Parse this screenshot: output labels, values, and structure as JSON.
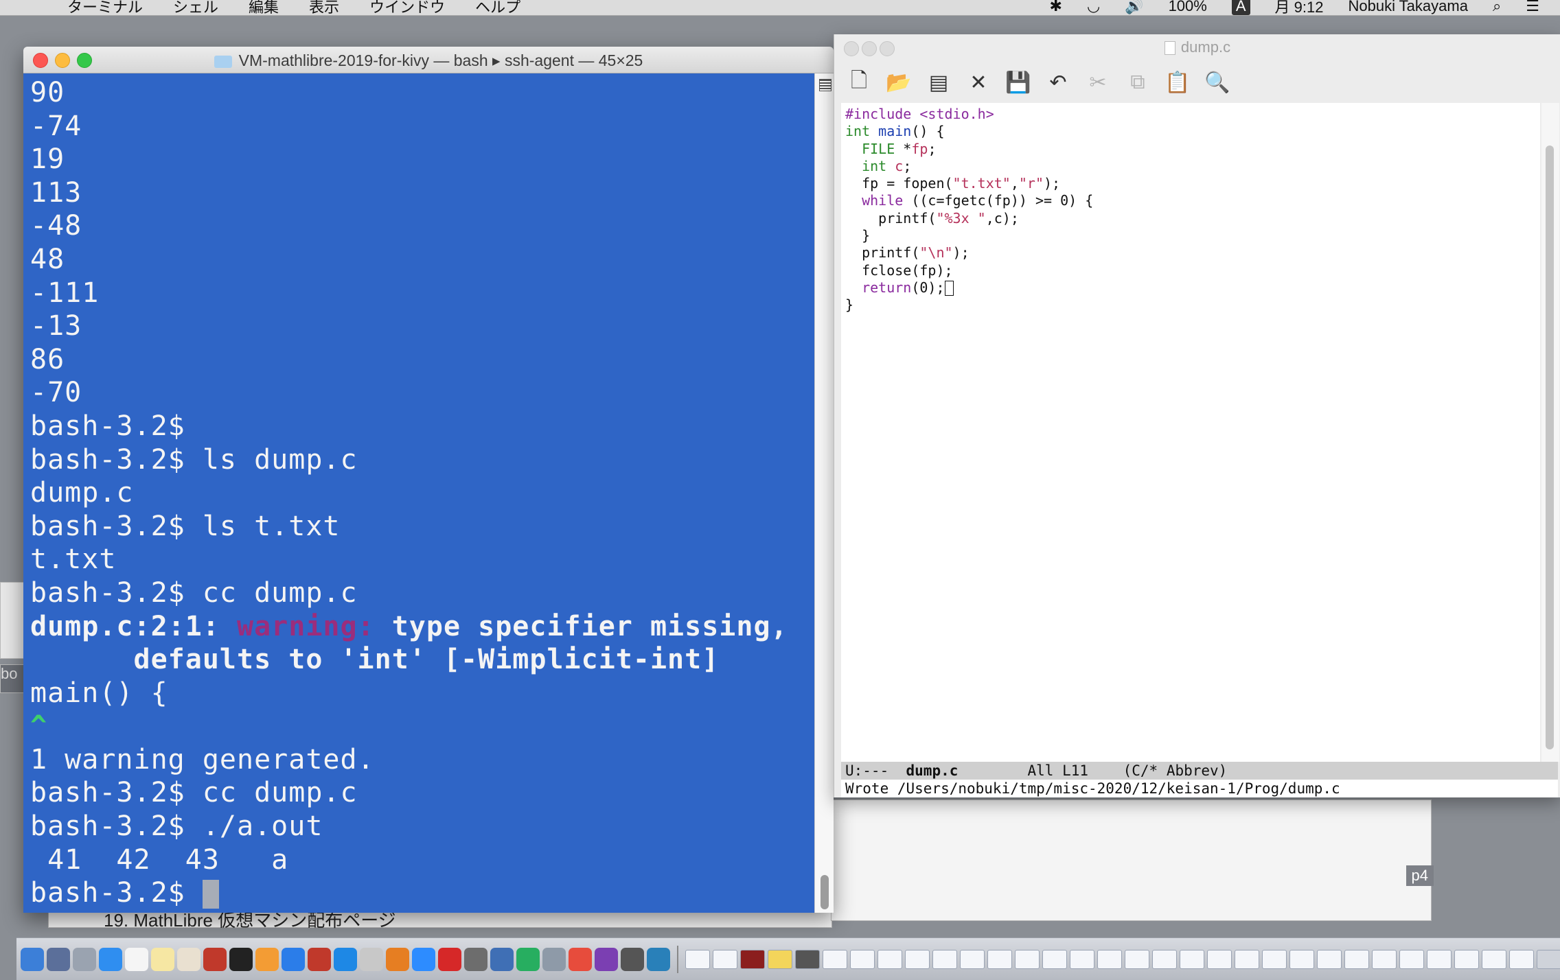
{
  "menubar": {
    "apple_glyph": "",
    "menus": [
      "ターミナル",
      "シェル",
      "編集",
      "表示",
      "ウインドウ",
      "ヘルプ"
    ],
    "battery": "100%",
    "input_method": "A",
    "clock": "月 9:12",
    "user": "Nobuki Takayama"
  },
  "terminal": {
    "title": "VM-mathlibre-2019-for-kivy — bash ▸ ssh-agent — 45×25",
    "lines": [
      "90",
      "-74",
      "19",
      "113",
      "-48",
      "48",
      "-111",
      "-13",
      "86",
      "-70",
      "bash-3.2$",
      "bash-3.2$ ls dump.c",
      "dump.c",
      "bash-3.2$ ls t.txt",
      "t.txt",
      "bash-3.2$ cc dump.c"
    ],
    "warning": {
      "location": "dump.c:2:1: ",
      "label": "warning:",
      "message": " type specifier missing,",
      "message2": "      defaults to 'int' [-Wimplicit-int]"
    },
    "source_line": "main() {",
    "caret": "^",
    "after_lines": [
      "1 warning generated.",
      "bash-3.2$ cc dump.c",
      "bash-3.2$ ./a.out",
      " 41  42  43   a"
    ],
    "prompt": "bash-3.2$ "
  },
  "editor": {
    "title": "dump.c",
    "toolbar": [
      {
        "name": "new-file-icon",
        "glyph": "🗋",
        "enabled": true
      },
      {
        "name": "open-folder-icon",
        "glyph": "📂",
        "enabled": true
      },
      {
        "name": "dired-icon",
        "glyph": "▤",
        "enabled": true
      },
      {
        "name": "close-buffer-icon",
        "glyph": "✕",
        "enabled": true
      },
      {
        "name": "save-icon",
        "glyph": "💾",
        "enabled": false
      },
      {
        "name": "undo-icon",
        "glyph": "↶",
        "enabled": true
      },
      {
        "name": "cut-icon",
        "glyph": "✂",
        "enabled": false
      },
      {
        "name": "copy-icon",
        "glyph": "⧉",
        "enabled": false
      },
      {
        "name": "paste-icon",
        "glyph": "📋",
        "enabled": true
      },
      {
        "name": "search-icon",
        "glyph": "🔍",
        "enabled": true
      }
    ],
    "code": {
      "l1": "#include <stdio.h>",
      "l2a": "int",
      "l2b": " ",
      "l2c": "main",
      "l2d": "() {",
      "l3a": "  FILE",
      "l3b": " *",
      "l3c": "fp",
      "l3d": ";",
      "l4a": "  int",
      "l4b": " ",
      "l4c": "c",
      "l4d": ";",
      "l5a": "  fp = fopen(",
      "l5b": "\"t.txt\"",
      "l5c": ",",
      "l5d": "\"r\"",
      "l5e": ");",
      "l6a": "  while",
      "l6b": " ((c=fgetc(fp)) >= 0) {",
      "l7a": "    printf(",
      "l7b": "\"%3x \"",
      "l7c": ",c);",
      "l8": "  }",
      "l9a": "  printf(",
      "l9b": "\"\\n\"",
      "l9c": ");",
      "l10": "  fclose(fp);",
      "l11a": "  return",
      "l11b": "(0);",
      "l12": "}"
    },
    "modeline": {
      "status": "U:---  ",
      "buffer": "dump.c",
      "position": "        All L11",
      "mode": "    (C/* Abbrev)"
    },
    "echo": "Wrote /Users/nobuki/tmp/misc-2020/12/keisan-1/Prog/dump.c"
  },
  "background": {
    "left_tag": "bo",
    "lower_tag": "p4",
    "underterm_text": "19. MathLibre 仮想マシン配布ページ"
  }
}
